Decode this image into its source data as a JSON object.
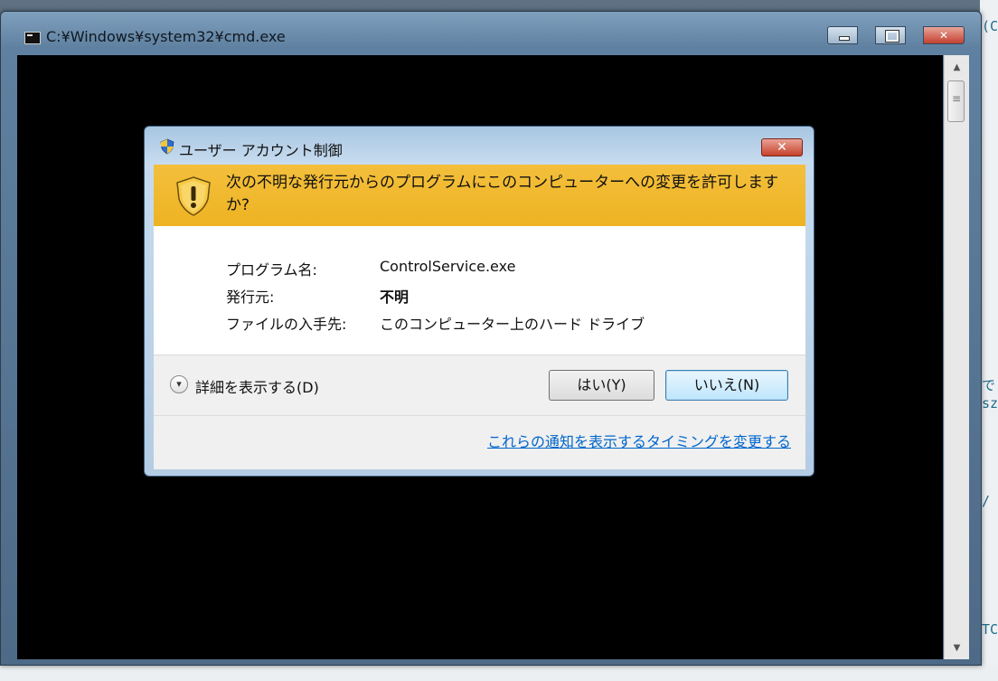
{
  "background": {
    "right_text": [
      "(C",
      "で",
      "sz",
      "/",
      "TC"
    ]
  },
  "cmd_window": {
    "title": "C:¥Windows¥system32¥cmd.exe",
    "icon": "console-icon",
    "buttons": {
      "minimize": "minimize-icon",
      "maximize": "maximize-icon",
      "close": "close-icon"
    }
  },
  "uac_dialog": {
    "title": "ユーザー アカウント制御",
    "close_label": "✕",
    "question": "次の不明な発行元からのプログラムにこのコンピューターへの変更を許可しますか?",
    "details": [
      {
        "label": "プログラム名:",
        "value": "ControlService.exe"
      },
      {
        "label": "発行元:",
        "value": "不明"
      },
      {
        "label": "ファイルの入手先:",
        "value": "このコンピューター上のハード ドライブ"
      }
    ],
    "expand_label": "詳細を表示する(D)",
    "yes_label": "はい(Y)",
    "no_label": "いいえ(N)",
    "change_link": "これらの通知を表示するタイミングを変更する",
    "colors": {
      "header": "#F0B62E",
      "link": "#0066CC"
    }
  }
}
